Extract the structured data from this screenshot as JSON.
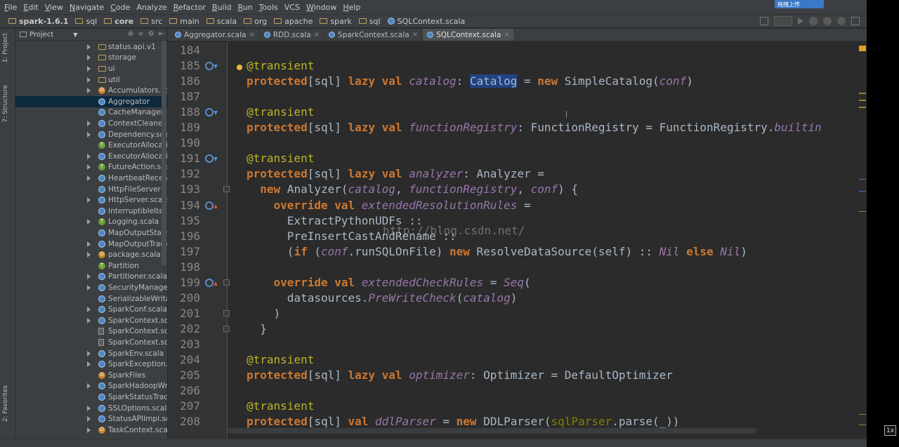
{
  "menu": [
    {
      "label": "File",
      "mn": "F",
      "rest": "ile"
    },
    {
      "label": "Edit",
      "mn": "E",
      "rest": "dit"
    },
    {
      "label": "View",
      "mn": "V",
      "rest": "iew"
    },
    {
      "label": "Navigate",
      "mn": "N",
      "rest": "avigate"
    },
    {
      "label": "Code",
      "mn": "C",
      "rest": "ode"
    },
    {
      "label": "Analyze",
      "mn": "",
      "rest": "Analyze"
    },
    {
      "label": "Refactor",
      "mn": "R",
      "rest": "efactor"
    },
    {
      "label": "Build",
      "mn": "B",
      "rest": "uild"
    },
    {
      "label": "Run",
      "mn": "R",
      "rest": "un"
    },
    {
      "label": "Tools",
      "mn": "T",
      "rest": "ools"
    },
    {
      "label": "VCS",
      "mn": "",
      "rest": "VCS"
    },
    {
      "label": "Window",
      "mn": "W",
      "rest": "indow"
    },
    {
      "label": "Help",
      "mn": "H",
      "rest": "elp"
    }
  ],
  "breadcrumbs": [
    "spark-1.6.1",
    "sql",
    "core",
    "src",
    "main",
    "scala",
    "org",
    "apache",
    "spark",
    "sql",
    "SQLContext.scala"
  ],
  "upload_badge": "拖拽上传",
  "left_strip": {
    "project_tab": "1: Project",
    "structure_tab": "7: Structure",
    "favorites_tab": "2: Favorites"
  },
  "project_panel": {
    "title": "Project",
    "tree": [
      {
        "label": "status.api.v1",
        "icon": "folder",
        "arrow": true
      },
      {
        "label": "storage",
        "icon": "folder",
        "arrow": true
      },
      {
        "label": "ui",
        "icon": "folder",
        "arrow": true
      },
      {
        "label": "util",
        "icon": "folder",
        "arrow": true
      },
      {
        "label": "Accumulators.scala",
        "icon": "object",
        "arrow": true
      },
      {
        "label": "Aggregator",
        "icon": "scala",
        "arrow": false,
        "selected": true
      },
      {
        "label": "CacheManager",
        "icon": "scala",
        "arrow": false
      },
      {
        "label": "ContextCleaner.scala",
        "icon": "scala",
        "arrow": true
      },
      {
        "label": "Dependency.scala",
        "icon": "scala",
        "arrow": true
      },
      {
        "label": "ExecutorAllocation",
        "icon": "trait",
        "arrow": false
      },
      {
        "label": "ExecutorAllocation",
        "icon": "scala",
        "arrow": true
      },
      {
        "label": "FutureAction.scala",
        "icon": "trait",
        "arrow": true
      },
      {
        "label": "HeartbeatReceiver",
        "icon": "scala",
        "arrow": true
      },
      {
        "label": "HttpFileServer",
        "icon": "scala",
        "arrow": false
      },
      {
        "label": "HttpServer.scala",
        "icon": "scala",
        "arrow": true
      },
      {
        "label": "InterruptibleIterat",
        "icon": "scala",
        "arrow": false
      },
      {
        "label": "Logging.scala",
        "icon": "trait",
        "arrow": true
      },
      {
        "label": "MapOutputStatist",
        "icon": "scala",
        "arrow": false
      },
      {
        "label": "MapOutputTracke",
        "icon": "scala",
        "arrow": true
      },
      {
        "label": "package.scala",
        "icon": "object",
        "arrow": true
      },
      {
        "label": "Partition",
        "icon": "trait",
        "arrow": false
      },
      {
        "label": "Partitioner.scala",
        "icon": "scala",
        "arrow": true
      },
      {
        "label": "SecurityManager.s",
        "icon": "scala",
        "arrow": true
      },
      {
        "label": "SerializableWritab",
        "icon": "scala",
        "arrow": false
      },
      {
        "label": "SparkConf.scala",
        "icon": "scala",
        "arrow": true
      },
      {
        "label": "SparkContext.scal",
        "icon": "scala",
        "arrow": true
      },
      {
        "label": "SparkContext.scal",
        "icon": "file",
        "arrow": false
      },
      {
        "label": "SparkContext.scal",
        "icon": "file",
        "arrow": false
      },
      {
        "label": "SparkEnv.scala",
        "icon": "scala",
        "arrow": true
      },
      {
        "label": "SparkException.sc",
        "icon": "scala",
        "arrow": true
      },
      {
        "label": "SparkFiles",
        "icon": "object",
        "arrow": false
      },
      {
        "label": "SparkHadoopWrit",
        "icon": "scala",
        "arrow": true
      },
      {
        "label": "SparkStatusTracke",
        "icon": "scala",
        "arrow": false
      },
      {
        "label": "SSLOptions.scala",
        "icon": "scala",
        "arrow": true
      },
      {
        "label": "StatusAPIImpl.sca",
        "icon": "scala",
        "arrow": true
      },
      {
        "label": "TaskContext.scala",
        "icon": "object",
        "arrow": true
      }
    ]
  },
  "tabs": [
    {
      "label": "Aggregator.scala",
      "active": false
    },
    {
      "label": "RDD.scala",
      "active": false
    },
    {
      "label": "SparkContext.scala",
      "active": false
    },
    {
      "label": "SQLContext.scala",
      "active": true
    }
  ],
  "tab_close": "×",
  "editor": {
    "watermark": "http://blog.csdn.net/",
    "lines": [
      {
        "n": "184",
        "html": ""
      },
      {
        "n": "185",
        "html": "<span class='an'>@transient</span>",
        "mark": "down"
      },
      {
        "n": "186",
        "html": "<span class='kw'>protected</span>[sql] <span class='kw'>lazy val</span> <span class='fn'>catalog</span>: <span class='hl'>Catalog</span> = <span class='kw'>new</span> SimpleCatalog(<span class='it'>conf</span>)"
      },
      {
        "n": "187",
        "html": ""
      },
      {
        "n": "188",
        "html": "<span class='an'>@transient</span>",
        "mark": "down"
      },
      {
        "n": "189",
        "html": "<span class='kw'>protected</span>[sql] <span class='kw'>lazy val</span> <span class='fn'>functionRegistry</span>: FunctionRegistry = FunctionRegistry.<span class='it'>builtin</span>"
      },
      {
        "n": "190",
        "html": ""
      },
      {
        "n": "191",
        "html": "<span class='an'>@transient</span>",
        "mark": "down"
      },
      {
        "n": "192",
        "html": "<span class='kw'>protected</span>[sql] <span class='kw'>lazy val</span> <span class='fn'>analyzer</span>: Analyzer ="
      },
      {
        "n": "193",
        "html": "  <span class='kw'>new</span> Analyzer(<span class='it'>catalog</span>, <span class='it'>functionRegistry</span>, <span class='it'>conf</span>) {",
        "fold": true
      },
      {
        "n": "194",
        "html": "    <span class='kw'>override val</span> <span class='fn'>extendedResolutionRules</span> =",
        "mark": "up"
      },
      {
        "n": "195",
        "html": "      ExtractPythonUDFs ::"
      },
      {
        "n": "196",
        "html": "      PreInsertCastAndRename ::"
      },
      {
        "n": "197",
        "html": "      (<span class='kw'>if</span> (<span class='it'>conf</span>.runSQLOnFile) <span class='kw'>new</span> ResolveDataSource(self) :: <span class='it'>Nil</span> <span class='kw'>else</span> <span class='it'>Nil</span>)"
      },
      {
        "n": "198",
        "html": ""
      },
      {
        "n": "199",
        "html": "    <span class='kw'>override val</span> <span class='fn'>extendedCheckRules</span> = <span class='it'>Seq</span>(",
        "mark": "up",
        "fold": true
      },
      {
        "n": "200",
        "html": "      datasources.<span class='it'>PreWriteCheck</span>(<span class='it'>catalog</span>)"
      },
      {
        "n": "201",
        "html": "    )",
        "fold": true
      },
      {
        "n": "202",
        "html": "  }",
        "fold": true
      },
      {
        "n": "203",
        "html": ""
      },
      {
        "n": "204",
        "html": "<span class='an'>@transient</span>"
      },
      {
        "n": "205",
        "html": "<span class='kw'>protected</span>[sql] <span class='kw'>lazy val</span> <span class='fn'>optimizer</span>: Optimizer = DefaultOptimizer"
      },
      {
        "n": "206",
        "html": ""
      },
      {
        "n": "207",
        "html": "<span class='an'>@transient</span>"
      },
      {
        "n": "208",
        "html": "<span class='kw'>protected</span>[sql] <span class='kw'>val</span> <span class='fn'>ddlParser</span> = <span class='kw'>new</span> DDLParser(<span class='dim'>sqlParser</span>.parse(_))"
      }
    ]
  },
  "zoom_badge": "1x",
  "colors": {
    "bg": "#2b2b2b",
    "keyword": "#cc7832",
    "annotation": "#bbb529",
    "field": "#9876aa",
    "selection": "#214283"
  }
}
